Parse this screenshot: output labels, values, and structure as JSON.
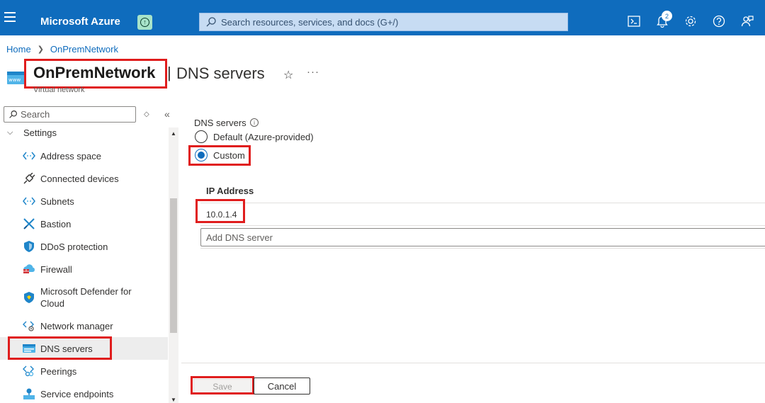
{
  "topbar": {
    "brand": "Microsoft Azure",
    "search_placeholder": "Search resources, services, and docs (G+/)",
    "notification_count": "2",
    "color": "#0f6cbd",
    "icons": [
      "menu-icon",
      "upgrade-icon",
      "search-icon",
      "cloud-shell-icon",
      "notifications-icon",
      "settings-icon",
      "help-icon",
      "feedback-icon"
    ]
  },
  "breadcrumb": {
    "home": "Home",
    "resource": "OnPremNetwork"
  },
  "header": {
    "resource_name": "OnPremNetwork",
    "separator": "|",
    "page_title": "DNS servers",
    "resource_type": "Virtual network"
  },
  "sidebar": {
    "search_placeholder": "Search",
    "group_label": "Settings",
    "items": [
      {
        "label": "Address space",
        "icon": "address-space-icon"
      },
      {
        "label": "Connected devices",
        "icon": "plug-icon"
      },
      {
        "label": "Subnets",
        "icon": "subnets-icon"
      },
      {
        "label": "Bastion",
        "icon": "bastion-icon"
      },
      {
        "label": "DDoS protection",
        "icon": "shield-icon"
      },
      {
        "label": "Firewall",
        "icon": "firewall-icon"
      },
      {
        "label": "Microsoft Defender for",
        "label2": "Cloud",
        "icon": "defender-icon"
      },
      {
        "label": "Network manager",
        "icon": "network-manager-icon"
      },
      {
        "label": "DNS servers",
        "icon": "dns-icon",
        "active": true
      },
      {
        "label": "Peerings",
        "icon": "peerings-icon"
      },
      {
        "label": "Service endpoints",
        "icon": "service-endpoints-icon"
      }
    ]
  },
  "main": {
    "dns_label": "DNS servers",
    "options": [
      {
        "label": "Default (Azure-provided)",
        "selected": false
      },
      {
        "label": "Custom",
        "selected": true
      }
    ],
    "ip_header": "IP Address",
    "ip_values": [
      "10.0.1.4"
    ],
    "add_placeholder": "Add DNS server",
    "save_label": "Save",
    "cancel_label": "Cancel"
  },
  "highlight_color": "#e01d1d"
}
